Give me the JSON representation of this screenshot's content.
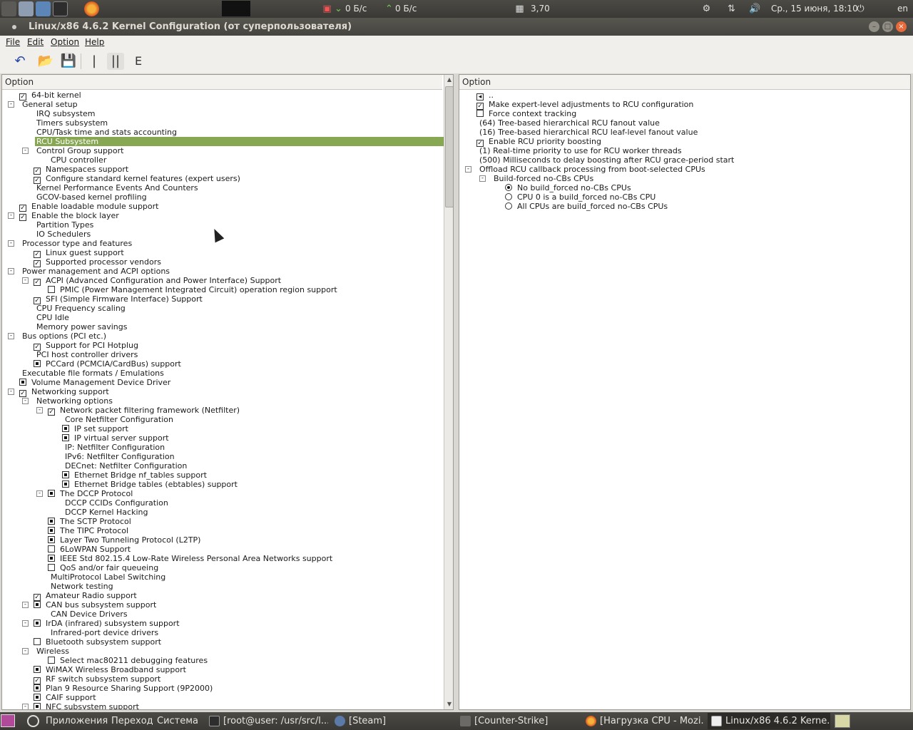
{
  "top_panel": {
    "net_down": "0 Б/с",
    "net_up": "0 Б/с",
    "load": "3,70",
    "datetime": "Ср., 15 июня, 18:10",
    "keyboard_layout": "en"
  },
  "window": {
    "title": "Linux/x86 4.6.2 Kernel Configuration (от суперпользователя)"
  },
  "menu": [
    "File",
    "Edit",
    "Option",
    "Help"
  ],
  "left_panel": {
    "header": "Option",
    "rows": [
      {
        "label": "64-bit kernel",
        "level": 0,
        "check": "on"
      },
      {
        "label": "General setup",
        "level": 0,
        "expander": "-"
      },
      {
        "label": "IRQ subsystem",
        "level": 1
      },
      {
        "label": "Timers subsystem",
        "level": 1
      },
      {
        "label": "CPU/Task time and stats accounting",
        "level": 1
      },
      {
        "label": "RCU Subsystem",
        "level": 1,
        "selected": true
      },
      {
        "label": "Control Group support",
        "level": 1,
        "expander": "-"
      },
      {
        "label": "CPU controller",
        "level": 2
      },
      {
        "label": "Namespaces support",
        "level": 1,
        "check": "on"
      },
      {
        "label": "Configure standard kernel features (expert users)",
        "level": 1,
        "check": "on"
      },
      {
        "label": "Kernel Performance Events And Counters",
        "level": 1
      },
      {
        "label": "GCOV-based kernel profiling",
        "level": 1
      },
      {
        "label": "Enable loadable module support",
        "level": 0,
        "check": "on"
      },
      {
        "label": "Enable the block layer",
        "level": 0,
        "check": "on",
        "expander": "-"
      },
      {
        "label": "Partition Types",
        "level": 1
      },
      {
        "label": "IO Schedulers",
        "level": 1
      },
      {
        "label": "Processor type and features",
        "level": 0,
        "expander": "-"
      },
      {
        "label": "Linux guest support",
        "level": 1,
        "check": "on"
      },
      {
        "label": "Supported processor vendors",
        "level": 1,
        "check": "on"
      },
      {
        "label": "Power management and ACPI options",
        "level": 0,
        "expander": "-"
      },
      {
        "label": "ACPI (Advanced Configuration and Power Interface) Support",
        "level": 1,
        "check": "on",
        "expander": "-"
      },
      {
        "label": "PMIC (Power Management Integrated Circuit) operation region support",
        "level": 2,
        "check": "off"
      },
      {
        "label": "SFI (Simple Firmware Interface) Support",
        "level": 1,
        "check": "on"
      },
      {
        "label": "CPU Frequency scaling",
        "level": 1
      },
      {
        "label": "CPU Idle",
        "level": 1
      },
      {
        "label": "Memory power savings",
        "level": 1
      },
      {
        "label": "Bus options (PCI etc.)",
        "level": 0,
        "expander": "-"
      },
      {
        "label": "Support for PCI Hotplug",
        "level": 1,
        "check": "on"
      },
      {
        "label": "PCI host controller drivers",
        "level": 1
      },
      {
        "label": "PCCard (PCMCIA/CardBus) support",
        "level": 1,
        "check": "mod"
      },
      {
        "label": "Executable file formats / Emulations",
        "level": 0
      },
      {
        "label": "Volume Management Device Driver",
        "level": 0,
        "check": "mod"
      },
      {
        "label": "Networking support",
        "level": 0,
        "check": "on",
        "expander": "-"
      },
      {
        "label": "Networking options",
        "level": 1,
        "expander": "-"
      },
      {
        "label": "Network packet filtering framework (Netfilter)",
        "level": 2,
        "check": "on",
        "expander": "-"
      },
      {
        "label": "Core Netfilter Configuration",
        "level": 3
      },
      {
        "label": "IP set support",
        "level": 3,
        "check": "mod"
      },
      {
        "label": "IP virtual server support",
        "level": 3,
        "check": "mod"
      },
      {
        "label": "IP: Netfilter Configuration",
        "level": 3
      },
      {
        "label": "IPv6: Netfilter Configuration",
        "level": 3
      },
      {
        "label": "DECnet: Netfilter Configuration",
        "level": 3
      },
      {
        "label": "Ethernet Bridge nf_tables support",
        "level": 3,
        "check": "mod"
      },
      {
        "label": "Ethernet Bridge tables (ebtables) support",
        "level": 3,
        "check": "mod"
      },
      {
        "label": "The DCCP Protocol",
        "level": 2,
        "check": "mod",
        "expander": "-"
      },
      {
        "label": "DCCP CCIDs Configuration",
        "level": 3
      },
      {
        "label": "DCCP Kernel Hacking",
        "level": 3
      },
      {
        "label": "The SCTP Protocol",
        "level": 2,
        "check": "mod"
      },
      {
        "label": "The TIPC Protocol",
        "level": 2,
        "check": "mod"
      },
      {
        "label": "Layer Two Tunneling Protocol (L2TP)",
        "level": 2,
        "check": "mod"
      },
      {
        "label": "6LoWPAN Support",
        "level": 2,
        "check": "off"
      },
      {
        "label": "IEEE Std 802.15.4 Low-Rate Wireless Personal Area Networks support",
        "level": 2,
        "check": "mod"
      },
      {
        "label": "QoS and/or fair queueing",
        "level": 2,
        "check": "off"
      },
      {
        "label": "MultiProtocol Label Switching",
        "level": 2
      },
      {
        "label": "Network testing",
        "level": 2
      },
      {
        "label": "Amateur Radio support",
        "level": 1,
        "check": "on"
      },
      {
        "label": "CAN bus subsystem support",
        "level": 1,
        "check": "mod",
        "expander": "-"
      },
      {
        "label": "CAN Device Drivers",
        "level": 2
      },
      {
        "label": "IrDA (infrared) subsystem support",
        "level": 1,
        "check": "mod",
        "expander": "-"
      },
      {
        "label": "Infrared-port device drivers",
        "level": 2
      },
      {
        "label": "Bluetooth subsystem support",
        "level": 1,
        "check": "off"
      },
      {
        "label": "Wireless",
        "level": 1,
        "expander": "-"
      },
      {
        "label": "Select mac80211 debugging features",
        "level": 2,
        "check": "off"
      },
      {
        "label": "WiMAX Wireless Broadband support",
        "level": 1,
        "check": "mod"
      },
      {
        "label": "RF switch subsystem support",
        "level": 1,
        "check": "on"
      },
      {
        "label": "Plan 9 Resource Sharing Support (9P2000)",
        "level": 1,
        "check": "mod"
      },
      {
        "label": "CAIF support",
        "level": 1,
        "check": "mod"
      },
      {
        "label": "NFC subsystem support",
        "level": 1,
        "check": "mod",
        "expander": "-"
      }
    ]
  },
  "right_panel": {
    "header": "Option",
    "rows": [
      {
        "label": "..",
        "level": 0,
        "check": "back"
      },
      {
        "label": "Make expert-level adjustments to RCU configuration",
        "level": 0,
        "check": "on"
      },
      {
        "label": "Force context tracking",
        "level": 0,
        "check": "off"
      },
      {
        "label": "(64) Tree-based hierarchical RCU fanout value",
        "level": 0
      },
      {
        "label": "(16) Tree-based hierarchical RCU leaf-level fanout value",
        "level": 0
      },
      {
        "label": "Enable RCU priority boosting",
        "level": 0,
        "check": "on"
      },
      {
        "label": "(1) Real-time priority to use for RCU worker threads",
        "level": 0
      },
      {
        "label": "(500) Milliseconds to delay boosting after RCU grace-period start",
        "level": 0
      },
      {
        "label": "Offload RCU callback processing from boot-selected CPUs",
        "level": 0,
        "expander": "-"
      },
      {
        "label": "Build-forced no-CBs CPUs",
        "level": 1,
        "expander": "-"
      },
      {
        "label": "No build_forced no-CBs CPUs",
        "level": 2,
        "radio": "on"
      },
      {
        "label": "CPU 0 is a build_forced no-CBs CPU",
        "level": 2,
        "radio": "off"
      },
      {
        "label": "All CPUs are build_forced no-CBs CPUs",
        "level": 2,
        "radio": "off"
      }
    ]
  },
  "bottom_panel": {
    "apps_menu": "Приложения",
    "places_menu": "Переход",
    "system_menu": "Система",
    "tasks": [
      {
        "label": "[root@user: /usr/src/l..."
      },
      {
        "label": "[Steam]"
      },
      {
        "label": "[Counter-Strike]"
      },
      {
        "label": "[Нагрузка CPU - Mozi..."
      },
      {
        "label": "Linux/x86 4.6.2 Kerne...",
        "active": true
      }
    ]
  }
}
